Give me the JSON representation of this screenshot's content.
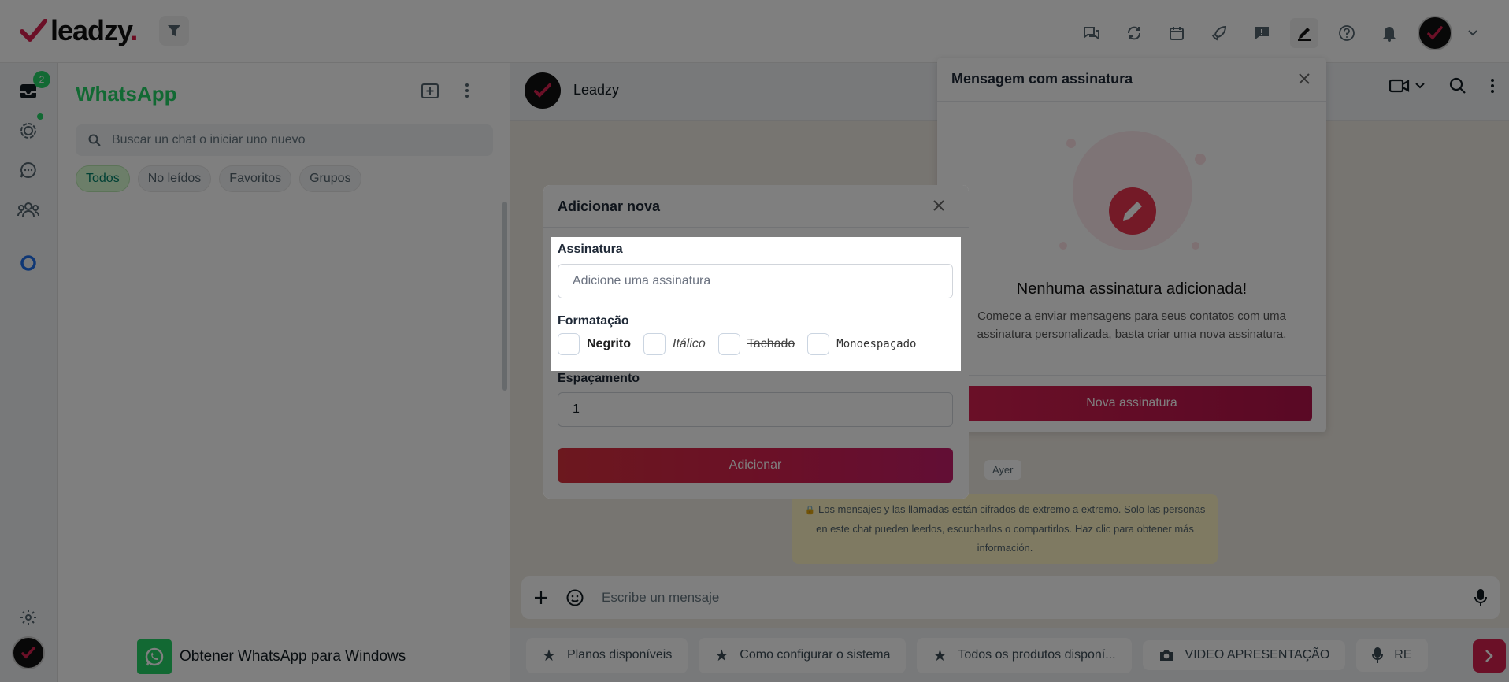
{
  "app": {
    "logo_text": "leadzy",
    "logo_dot": "."
  },
  "topbar": {
    "icons": [
      "chats-icon",
      "sync-icon",
      "calendar-icon",
      "rocket-icon",
      "message-alert-icon",
      "pen-icon",
      "help-icon",
      "bell-icon"
    ]
  },
  "rail": {
    "inbox_badge": "2"
  },
  "chatlist": {
    "title": "WhatsApp",
    "search_placeholder": "Buscar un chat o iniciar uno nuevo",
    "filters": [
      "Todos",
      "No leídos",
      "Favoritos",
      "Grupos"
    ],
    "active_filter": "Todos",
    "get_app": "Obtener WhatsApp para Windows"
  },
  "conversation": {
    "contact_name": "Leadzy",
    "day_label": "Ayer",
    "encryption_note": "Los mensajes y las llamadas están cifrados de extremo a extremo. Solo las personas en este chat pueden leerlos, escucharlos o compartirlos. Haz clic para obtener más información.",
    "composer_placeholder": "Escribe un mensaje",
    "quick_replies": [
      {
        "icon": "star-icon",
        "label": "Planos disponíveis"
      },
      {
        "icon": "star-icon",
        "label": "Como configurar o sistema"
      },
      {
        "icon": "star-icon",
        "label": "Todos os produtos disponí..."
      },
      {
        "icon": "camera-icon",
        "label": "VIDEO APRESENTAÇÃO"
      },
      {
        "icon": "mic-icon",
        "label": "RE"
      }
    ]
  },
  "signature_panel": {
    "title": "Mensagem com assinatura",
    "empty_title": "Nenhuma assinatura adicionada!",
    "empty_desc": "Comece a enviar mensagens para seus contatos com uma assinatura personalizada, basta criar uma nova assinatura.",
    "new_button": "Nova assinatura"
  },
  "modal": {
    "title": "Adicionar nova",
    "signature_label": "Assinatura",
    "signature_placeholder": "Adicione uma assinatura",
    "format_label": "Formatação",
    "formats": {
      "bold": "Negrito",
      "italic": "Itálico",
      "strike": "Tachado",
      "mono": "Monoespaçado"
    },
    "spacing_label": "Espaçamento",
    "spacing_value": "1",
    "submit": "Adicionar"
  },
  "colors": {
    "brand": "#d6204f",
    "whatsapp_green": "#25d366",
    "overlay": "rgba(0,0,0,0.5)"
  }
}
